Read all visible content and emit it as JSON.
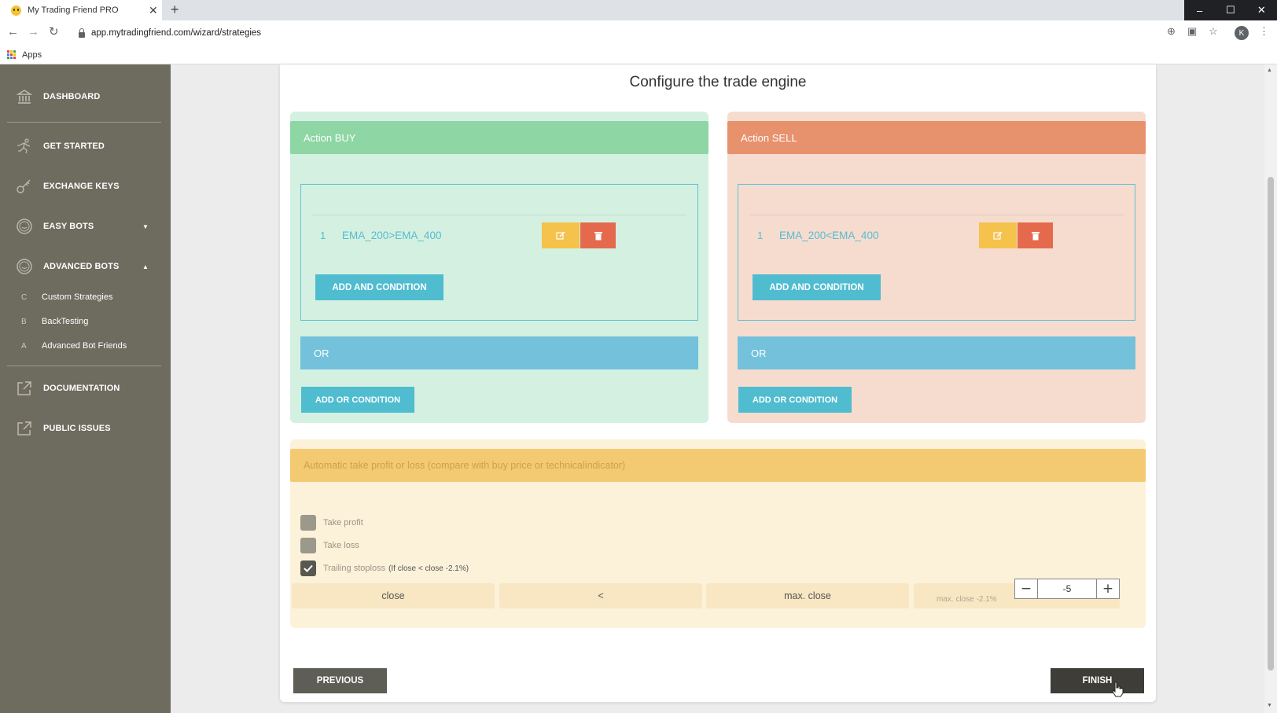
{
  "browser": {
    "tab_title": "My Trading Friend PRO",
    "tab_close": "✕",
    "new_tab": "+",
    "url": "app.mytradingfriend.com/wizard/strategies",
    "bookmarks_apps": "Apps",
    "profile_initial": "K",
    "window_controls": [
      "–",
      "☐",
      "✕"
    ]
  },
  "sidebar": {
    "items": [
      {
        "label": "DASHBOARD",
        "icon": "bank-icon"
      },
      {
        "label": "GET STARTED",
        "icon": "runner-icon"
      },
      {
        "label": "EXCHANGE KEYS",
        "icon": "key-icon"
      },
      {
        "label": "EASY BOTS",
        "icon": "smiley-icon",
        "caret": "▼"
      },
      {
        "label": "ADVANCED BOTS",
        "icon": "smiley-icon",
        "caret": "▲"
      }
    ],
    "subitems": [
      {
        "letter": "C",
        "label": "Custom Strategies"
      },
      {
        "letter": "B",
        "label": "BackTesting"
      },
      {
        "letter": "A",
        "label": "Advanced Bot Friends"
      }
    ],
    "bottom_items": [
      {
        "label": "DOCUMENTATION",
        "icon": "external-link-icon"
      },
      {
        "label": "PUBLIC ISSUES",
        "icon": "external-link-icon"
      }
    ]
  },
  "main": {
    "title": "Configure the trade engine",
    "buy": {
      "header": "Action BUY",
      "condition_number": "1",
      "condition": "EMA_200>EMA_400",
      "add_and": "ADD AND CONDITION",
      "or_label": "OR",
      "add_or": "ADD OR CONDITION"
    },
    "sell": {
      "header": "Action SELL",
      "condition_number": "1",
      "condition": "EMA_200<EMA_400",
      "add_and": "ADD AND CONDITION",
      "or_label": "OR",
      "add_or": "ADD OR CONDITION"
    },
    "take_profit": {
      "header": "Automatic take profit or loss (compare with buy price or technicalindicator)",
      "options": [
        {
          "label": "Take profit",
          "checked": false,
          "extra": ""
        },
        {
          "label": "Take loss",
          "checked": false,
          "extra": ""
        },
        {
          "label": "Trailing stoploss",
          "checked": true,
          "extra": "(If close < close -2.1%)"
        }
      ],
      "expression": {
        "left": "close",
        "operator": "<",
        "right": "max. close",
        "hint": "max. close -2.1%",
        "stepper_value": "-5",
        "minus": "−",
        "plus": "+"
      }
    },
    "previous_label": "PREVIOUS",
    "finish_label": "FINISH"
  },
  "colors": {
    "sidebar_bg": "#6e6b5f",
    "buy_header": "#8ed6a4",
    "buy_panel": "#d4f0e0",
    "sell_header": "#e8916d",
    "sell_panel": "#f6dccf",
    "accent_teal": "#4fbccf",
    "or_bar": "#73c1db",
    "take_profit_header": "#f3ca72"
  }
}
